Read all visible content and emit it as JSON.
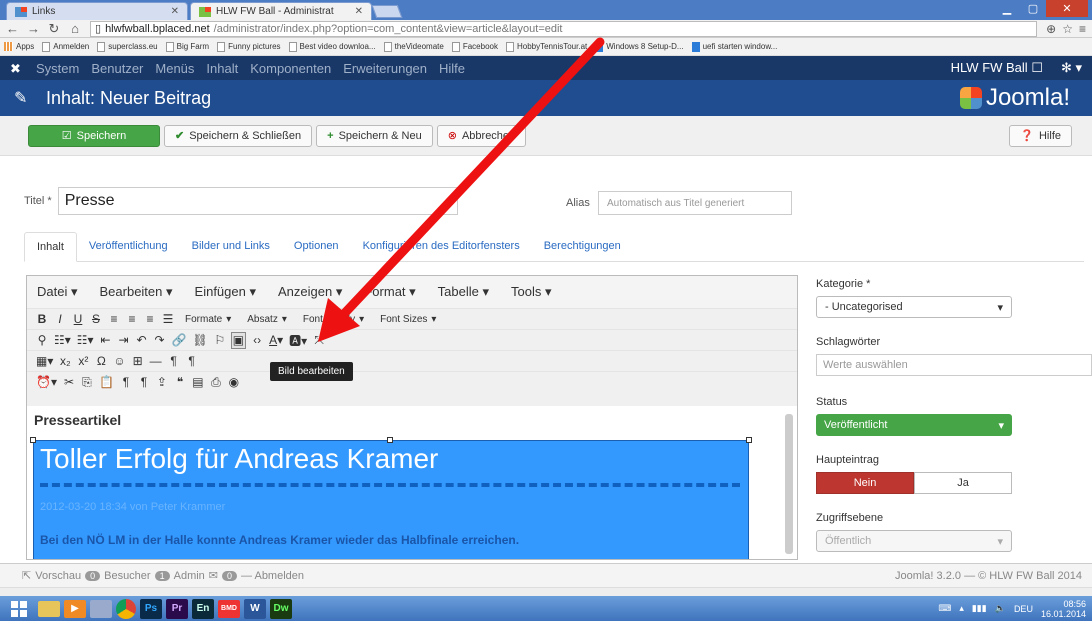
{
  "browser": {
    "tabs": [
      {
        "title": "Links",
        "active": false
      },
      {
        "title": "HLW FW Ball - Administrat",
        "active": true
      }
    ],
    "url_host": "hlwfwball.bplaced.net",
    "url_path": "/administrator/index.php?option=com_content&view=article&layout=edit",
    "bookmarks": [
      "Apps",
      "Anmelden",
      "superclass.eu",
      "Big Farm",
      "Funny pictures",
      "Best video downloa...",
      "theVideomate",
      "Facebook",
      "HobbyTennisTour.at",
      "Windows 8 Setup-D...",
      "uefi starten window..."
    ]
  },
  "nav": {
    "items": [
      "System",
      "Benutzer",
      "Menüs",
      "Inhalt",
      "Komponenten",
      "Erweiterungen",
      "Hilfe"
    ],
    "site_link": "HLW FW Ball ☐"
  },
  "header": {
    "title": "Inhalt: Neuer Beitrag",
    "logo": "Joomla!"
  },
  "toolbar": {
    "save": "Speichern",
    "save_close": "Speichern & Schließen",
    "save_new": "Speichern & Neu",
    "cancel": "Abbrechen",
    "help": "Hilfe"
  },
  "form": {
    "title_label": "Titel *",
    "title_value": "Presse",
    "alias_label": "Alias",
    "alias_placeholder": "Automatisch aus Titel generiert"
  },
  "tabs": [
    "Inhalt",
    "Veröffentlichung",
    "Bilder und Links",
    "Optionen",
    "Konfigurieren des Editorfensters",
    "Berechtigungen"
  ],
  "editor": {
    "menus": [
      "Datei ▾",
      "Bearbeiten ▾",
      "Einfügen ▾",
      "Anzeigen ▾",
      "Format ▾",
      "Tabelle ▾",
      "Tools ▾"
    ],
    "format_select": "Formate",
    "paragraph_select": "Absatz",
    "font_family": "Font Family",
    "font_sizes": "Font Sizes",
    "tooltip": "Bild bearbeiten",
    "content_heading": "Presseartikel",
    "article_title": "Toller Erfolg für Andreas Kramer",
    "article_meta": "2012-03-20 18:34 von Peter Krammer",
    "article_lead": "Bei den NÖ LM in der Halle konnte Andreas Kramer wieder das Halbfinale erreichen."
  },
  "sidebar": {
    "category_label": "Kategorie *",
    "category_value": "- Uncategorised",
    "tags_label": "Schlagwörter",
    "tags_placeholder": "Werte auswählen",
    "status_label": "Status",
    "status_value": "Veröffentlicht",
    "featured_label": "Haupteintrag",
    "featured_no": "Nein",
    "featured_yes": "Ja",
    "access_label": "Zugriffsebene",
    "access_value": "Öffentlich"
  },
  "footer": {
    "preview": "Vorschau",
    "visitors_count": "0",
    "visitors": "Besucher",
    "admin_count": "1",
    "admin": "Admin",
    "messages_count": "0",
    "logout": "— Abmelden",
    "version": "Joomla! 3.2.0 — © HLW FW Ball 2014"
  },
  "taskbar": {
    "apps": [
      "ps",
      "pr",
      "en",
      "bmd",
      "word",
      "dw"
    ],
    "labels": {
      "ps": "Ps",
      "pr": "Pr",
      "en": "En",
      "bmd": "BMD",
      "word": "W",
      "dw": "Dw"
    },
    "lang": "DEU",
    "time": "08:56",
    "date": "16.01.2014"
  },
  "colors": {
    "joomla_nav": "#1a3867",
    "joomla_title": "#1f4d8f",
    "save_green": "#46a546",
    "no_red": "#bd362f",
    "arrow_red": "#ee1111"
  }
}
